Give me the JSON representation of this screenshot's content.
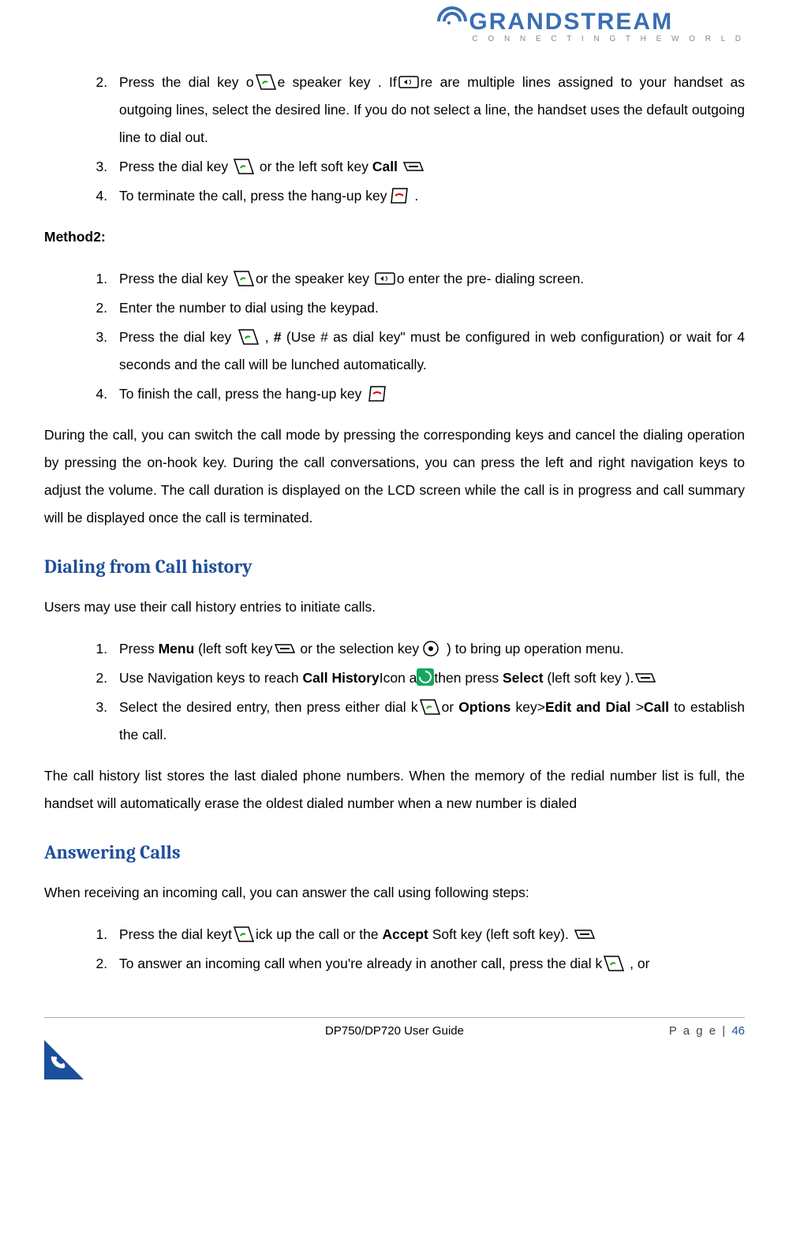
{
  "brand": {
    "name": "GRANDSTREAM",
    "tagline": "C O N N E C T I N G   T H E   W O R L D"
  },
  "continuation": {
    "items": [
      {
        "num": "2.",
        "text_a": "Press the dial key o",
        "text_b": "e speaker key       . If",
        "text_c": "re are multiple lines assigned to your handset as outgoing lines, select the desired line. If you do not select a line, the handset uses the default outgoing line to dial out."
      },
      {
        "num": "3.",
        "text_a": "Press the dial key ",
        "text_b": " or the left soft key ",
        "bold_a": "Call",
        "text_c": " "
      },
      {
        "num": "4.",
        "text_a": "To terminate the call, press the hang-up key",
        "text_b": " ."
      }
    ]
  },
  "method2": {
    "label": "Method2:",
    "items": [
      {
        "num": "1.",
        "text_a": "Press the dial key  ",
        "text_b": "or the speaker key   ",
        "text_c": "o enter the pre- dialing screen."
      },
      {
        "num": "2.",
        "text_a": "Enter the number to dial using the keypad."
      },
      {
        "num": "3.",
        "text_a": "Press the dial key  ",
        "text_b": " , ",
        "bold_a": "#",
        "text_c": " (Use # as dial key\" must be configured in web configuration) or wait for 4 seconds and the call will be lunched automatically."
      },
      {
        "num": "4.",
        "text_a": "To finish the call, press the hang-up key "
      }
    ]
  },
  "during_para": "During the call, you can switch the call mode by pressing the corresponding keys and cancel the dialing operation by pressing the on-hook key. During the call conversations, you can press the left and right navigation keys to adjust the volume. The call duration is displayed on the LCD screen while the call is in progress and call summary will be displayed once the call is terminated.",
  "history": {
    "heading": "Dialing from Call history",
    "intro": "Users may use their call history entries to initiate calls.",
    "items": [
      {
        "num": "1.",
        "text_a": "Press ",
        "bold_a": "Menu",
        "text_b": " (left soft key",
        "text_c": " or the selection key",
        "text_d": " ) to bring up operation menu."
      },
      {
        "num": "2.",
        "text_a": "Use Navigation keys to reach ",
        "bold_a": "Call History",
        "text_b": "Icon a",
        "text_c": "then press ",
        "bold_b": "Select",
        "text_d": " (left soft key        )."
      },
      {
        "num": "3.",
        "text_a": "Select the desired entry, then press either dial k",
        "text_b": "or ",
        "bold_a": "Options",
        "text_c": " key>",
        "bold_b": "Edit and Dial",
        "text_d": " >",
        "bold_c": "Call",
        "text_e": " to establish the call."
      }
    ],
    "footnote": "The call history list stores the last dialed phone numbers. When the memory of the redial number list is full, the handset will automatically erase the oldest dialed number when a new number is dialed"
  },
  "answering": {
    "heading": "Answering Calls",
    "intro": "When receiving an incoming call, you can answer the call using following steps:",
    "items": [
      {
        "num": "1.",
        "text_a": "Press the dial keyt",
        "text_b": "ick up the call or the ",
        "bold_a": "Accept",
        "text_c": " Soft key (left soft key).        "
      },
      {
        "num": "2.",
        "text_a": "To answer an incoming call when you're already in another call, press the dial k",
        "text_b": "     , or"
      }
    ]
  },
  "footer": {
    "guide": "DP750/DP720 User Guide",
    "page_label": "P a g e |",
    "page_num": "46"
  }
}
